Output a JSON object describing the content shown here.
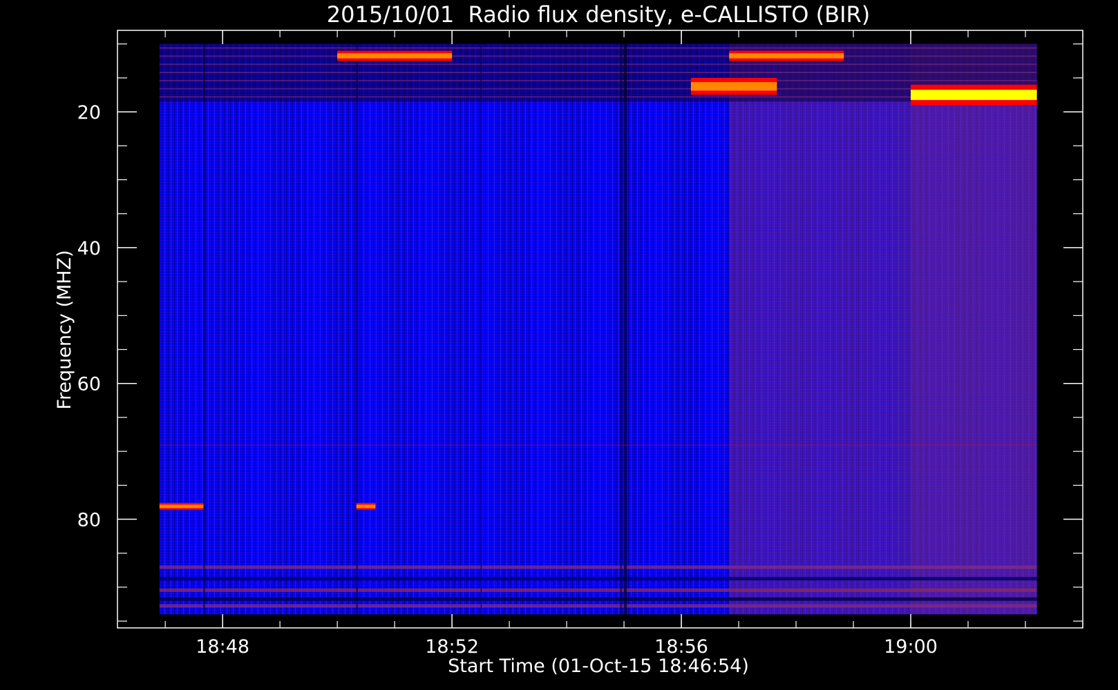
{
  "chart_data": {
    "type": "heatmap",
    "title": "2015/10/01  Radio flux density, e-CALLISTO (BIR)",
    "xlabel": "Start Time (01-Oct-15 18:46:54)",
    "ylabel": "Frequency (MHZ)",
    "x_range": [
      "18:46:54",
      "19:02:12"
    ],
    "y_range": [
      10,
      94
    ],
    "y_axis_inverted": true,
    "xlim": [
      "18:46:10",
      "19:03:00"
    ],
    "ylim": [
      8,
      96
    ],
    "x_ticks": [
      "18:48",
      "18:52",
      "18:56",
      "19:00"
    ],
    "y_ticks": [
      20,
      40,
      60,
      80
    ],
    "x_minor_every_min": 1,
    "y_minor_every_mhz": 5,
    "colormap": [
      "#000000",
      "#0000ff",
      "#7f2a7f",
      "#ff0000",
      "#ff8800",
      "#ffff00"
    ],
    "background_level": "blue",
    "bright_regions": [
      {
        "time": [
          "19:00:00",
          "19:02:12"
        ],
        "freq_mhz": [
          16,
          19
        ],
        "level": "yellow"
      },
      {
        "time": [
          "18:56:10",
          "18:57:40"
        ],
        "freq_mhz": [
          15,
          17.5
        ],
        "level": "orange"
      },
      {
        "time": [
          "18:50:00",
          "18:52:00"
        ],
        "freq_mhz": [
          11,
          12.5
        ],
        "level": "orange"
      },
      {
        "time": [
          "18:56:50",
          "18:58:50"
        ],
        "freq_mhz": [
          11,
          12.5
        ],
        "level": "orange"
      },
      {
        "time": [
          "18:46:54",
          "18:47:40"
        ],
        "freq_mhz": [
          77.6,
          78.6
        ],
        "level": "orange"
      },
      {
        "time": [
          "18:50:20",
          "18:50:40"
        ],
        "freq_mhz": [
          77.6,
          78.6
        ],
        "level": "orange"
      }
    ],
    "grid": false,
    "legend": "none"
  },
  "colors": {
    "background": "#000000",
    "axis": "#ffffff",
    "text": "#ffffff"
  }
}
